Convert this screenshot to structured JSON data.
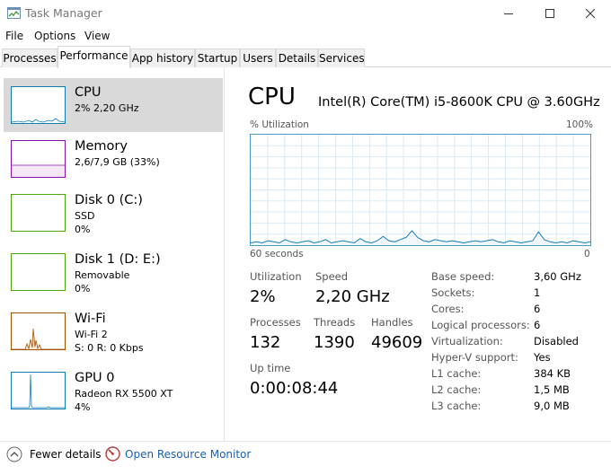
{
  "window": {
    "title": "Task Manager"
  },
  "menu": [
    "File",
    "Options",
    "View"
  ],
  "tabs": [
    "Processes",
    "Performance",
    "App history",
    "Startup",
    "Users",
    "Details",
    "Services"
  ],
  "active_tab": "Performance",
  "sidebar": [
    {
      "name": "CPU",
      "sub1": "2% 2,20 GHz",
      "sub2": "",
      "color": "#117dbb",
      "selected": true
    },
    {
      "name": "Memory",
      "sub1": "2,6/7,9 GB (33%)",
      "sub2": "",
      "color": "#8b12ae",
      "selected": false
    },
    {
      "name": "Disk 0 (C:)",
      "sub1": "SSD",
      "sub2": "0%",
      "color": "#4da60c",
      "selected": false
    },
    {
      "name": "Disk 1 (D: E:)",
      "sub1": "Removable",
      "sub2": "0%",
      "color": "#4da60c",
      "selected": false
    },
    {
      "name": "Wi-Fi",
      "sub1": "Wi-Fi 2",
      "sub2": "S: 0 R: 0 Kbps",
      "color": "#a74f01",
      "selected": false
    },
    {
      "name": "GPU 0",
      "sub1": "Radeon RX 5500 XT",
      "sub2": "4%",
      "color": "#117dbb",
      "selected": false
    }
  ],
  "detail": {
    "title": "CPU",
    "cpu_name": "Intel(R) Core(TM) i5-8600K CPU @ 3.60GHz",
    "graph": {
      "y_label": "% Utilization",
      "y_max_label": "100%",
      "x_left_label": "60 seconds",
      "x_right_label": "0",
      "samples": [
        2,
        3,
        2,
        4,
        3,
        2,
        5,
        3,
        2,
        3,
        4,
        2,
        3,
        5,
        2,
        3,
        4,
        3,
        2,
        6,
        3,
        2,
        4,
        8,
        4,
        3,
        5,
        7,
        13,
        7,
        4,
        3,
        5,
        4,
        3,
        4,
        3,
        2,
        3,
        4,
        3,
        4,
        5,
        3,
        2,
        4,
        3,
        2,
        3,
        4,
        12,
        5,
        3,
        2,
        3,
        2,
        4,
        3,
        2,
        3
      ]
    },
    "stats": {
      "utilization_label": "Utilization",
      "utilization": "2%",
      "speed_label": "Speed",
      "speed": "2,20 GHz",
      "processes_label": "Processes",
      "processes": "132",
      "threads_label": "Threads",
      "threads": "1390",
      "handles_label": "Handles",
      "handles": "49609",
      "uptime_label": "Up time",
      "uptime": "0:00:08:44"
    },
    "specs": [
      {
        "label": "Base speed:",
        "value": "3,60 GHz"
      },
      {
        "label": "Sockets:",
        "value": "1"
      },
      {
        "label": "Cores:",
        "value": "6"
      },
      {
        "label": "Logical processors:",
        "value": "6"
      },
      {
        "label": "Virtualization:",
        "value": "Disabled"
      },
      {
        "label": "Hyper-V support:",
        "value": "Yes"
      },
      {
        "label": "L1 cache:",
        "value": "384 KB"
      },
      {
        "label": "L2 cache:",
        "value": "1,5 MB"
      },
      {
        "label": "L3 cache:",
        "value": "9,0 MB"
      }
    ]
  },
  "footer": {
    "fewer_details": "Fewer details",
    "resource_monitor": "Open Resource Monitor"
  },
  "colors": {
    "cpu_line": "#117dbb",
    "cpu_fill": "#f1f6fa",
    "grid": "#d9eaf4",
    "link": "#1a5fb4"
  }
}
